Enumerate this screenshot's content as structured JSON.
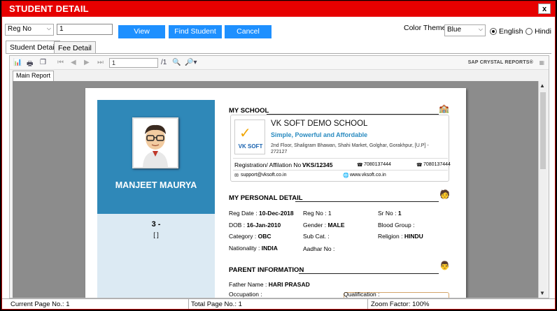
{
  "window": {
    "title": "STUDENT DETAIL",
    "close": "x"
  },
  "filter": {
    "search_by": "Reg No",
    "search_value": "1",
    "view_label": "View",
    "find_label": "Find Student",
    "cancel_label": "Cancel",
    "color_theme_label": "Color Theme",
    "color_theme_value": "Blue",
    "lang_english": "English",
    "lang_hindi": "Hindi"
  },
  "tabs": [
    "Student Detail",
    "Fee Detail"
  ],
  "viewer": {
    "page_input": "1",
    "page_total": "/1",
    "brand": "SAP CRYSTAL REPORTS®",
    "report_tab": "Main Report"
  },
  "report": {
    "student_name": "MANJEET MAURYA",
    "class": "3 -",
    "section": "[ ]",
    "my_school": {
      "heading": "MY SCHOOL",
      "logo_text": "VK SOFT",
      "name": "VK SOFT DEMO SCHOOL",
      "tagline": "Simple, Powerful and Affordable",
      "address": "2nd Floor, Shaligram Bhawan, Shahi Market, Golghar, Gorakhpur, [U.P] - 272127",
      "registration_label": "Registration/ Affilation No :",
      "registration_value": "VKS/12345",
      "phone1": "7080137444",
      "phone2": "7080137444",
      "email": "support@vksoft.co.in",
      "website": "www.vksoft.co.in"
    },
    "personal": {
      "heading": "MY PERSONAL DETAIL",
      "reg_date_label": "Reg Date :",
      "reg_date": "10-Dec-2018",
      "reg_no_label": "Reg No :",
      "reg_no": "1",
      "sr_no_label": "Sr No :",
      "sr_no": "1",
      "dob_label": "DOB :",
      "dob": "16-Jan-2010",
      "gender_label": "Gender :",
      "gender": "MALE",
      "blood_group_label": "Blood Group :",
      "blood_group": "",
      "category_label": "Category :",
      "category": "OBC",
      "sub_cat_label": "Sub Cat. :",
      "sub_cat": "",
      "religion_label": "Religion :",
      "religion": "HINDU",
      "nationality_label": "Nationality :",
      "nationality": "INDIA",
      "aadhar_label": "Aadhar No :",
      "aadhar": ""
    },
    "parent": {
      "heading": "PARENT INFORMATION",
      "father_label": "Father Name :",
      "father": "HARI PRASAD",
      "occupation_label": "Occupation :",
      "occupation": "",
      "qualification_label": "Qualification :",
      "qualification": ""
    }
  },
  "status": {
    "current_page": "Current Page No.: 1",
    "total_page": "Total Page No.: 1",
    "zoom": "Zoom Factor: 100%"
  }
}
